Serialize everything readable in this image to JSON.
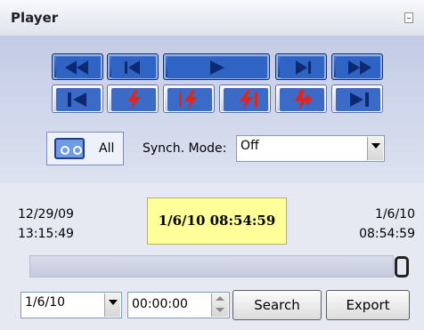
{
  "panel": {
    "title": "Player"
  },
  "transport": {
    "row1": [
      {
        "name": "fast-rewind-button",
        "icon": "fast-rewind-icon",
        "variant": "blue"
      },
      {
        "name": "skip-to-start-button",
        "icon": "skip-start-icon",
        "variant": "blue"
      },
      {
        "name": "play-button",
        "icon": "play-icon",
        "variant": "blue"
      },
      {
        "name": "skip-to-end-button",
        "icon": "skip-end-icon",
        "variant": "blue"
      },
      {
        "name": "fast-forward-button",
        "icon": "fast-forward-icon",
        "variant": "blue"
      }
    ],
    "row2": [
      {
        "name": "jump-first-button",
        "icon": "jump-first-icon"
      },
      {
        "name": "event-previous-button",
        "icon": "event-bolt-icon"
      },
      {
        "name": "event-back-button",
        "icon": "event-back-icon"
      },
      {
        "name": "event-forward-button",
        "icon": "event-forward-icon"
      },
      {
        "name": "event-next-button",
        "icon": "event-next-icon"
      },
      {
        "name": "jump-last-button",
        "icon": "jump-last-icon"
      }
    ]
  },
  "source": {
    "label": "All",
    "icon": "cassette-icon"
  },
  "sync": {
    "label": "Synch. Mode:",
    "value": "Off"
  },
  "timeline": {
    "start_date": "12/29/09",
    "start_time": "13:15:49",
    "current": "1/6/10 08:54:59",
    "end_date": "1/6/10",
    "end_time": "08:54:59",
    "position": 1.0
  },
  "search": {
    "date_value": "1/6/10",
    "time_value": "00:00:00",
    "search_label": "Search",
    "export_label": "Export"
  },
  "colors": {
    "accent_blue": "#1e4aa6",
    "event_red": "#e0261c",
    "highlight": "#ffff99"
  }
}
